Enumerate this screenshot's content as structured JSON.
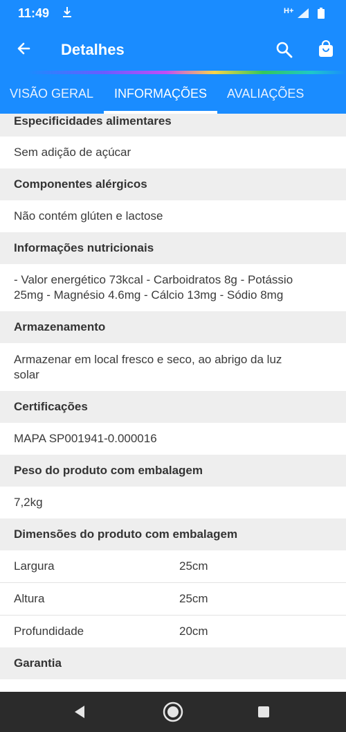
{
  "status_bar": {
    "time": "11:49",
    "network": "H+",
    "download_icon": "download-icon",
    "signal_icon": "signal-icon",
    "battery_icon": "battery-icon"
  },
  "app_bar": {
    "title": "Detalhes",
    "back_icon": "arrow-back-icon",
    "search_icon": "search-icon",
    "cart_icon": "shopping-bag-icon"
  },
  "tabs": [
    {
      "label": "VISÃO GERAL",
      "active": false
    },
    {
      "label": "INFORMAÇÕES",
      "active": true
    },
    {
      "label": "AVALIAÇÕES",
      "active": false
    }
  ],
  "sections": {
    "especificidades": {
      "title": "Especificidades alimentares",
      "value": "Sem adição de açúcar"
    },
    "alergicos": {
      "title": "Componentes alérgicos",
      "value": "Não contém glúten e lactose"
    },
    "nutricionais": {
      "title": "Informações nutricionais",
      "line1": "- Valor energético 73kcal - Carboidratos 8g - Potássio",
      "line2": "25mg - Magnésio 4.6mg - Cálcio 13mg - Sódio 8mg"
    },
    "armazenamento": {
      "title": "Armazenamento",
      "line1": "Armazenar em local fresco e seco, ao abrigo da luz",
      "line2": "solar"
    },
    "certificacoes": {
      "title": "Certificações",
      "value": "MAPA SP001941-0.000016"
    },
    "peso": {
      "title": "Peso do produto com embalagem",
      "value": "7,2kg"
    },
    "dimensoes": {
      "title": "Dimensões do produto com embalagem",
      "rows": [
        {
          "label": "Largura",
          "value": "25cm"
        },
        {
          "label": "Altura",
          "value": "25cm"
        },
        {
          "label": "Profundidade",
          "value": "20cm"
        }
      ]
    },
    "garantia": {
      "title": "Garantia"
    }
  },
  "colors": {
    "primary": "#1a8cff",
    "section_header_bg": "#eeeeee",
    "nav_bar": "#2b2b2b"
  },
  "nav_bar": {
    "back_icon": "nav-back-icon",
    "home_icon": "nav-home-icon",
    "recents_icon": "nav-recents-icon"
  }
}
